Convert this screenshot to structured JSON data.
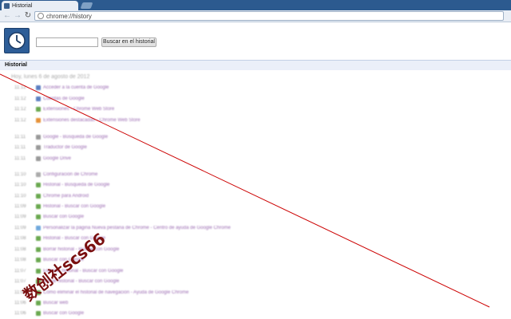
{
  "browser": {
    "tab_title": "Historial",
    "url_text": "chrome://history"
  },
  "page": {
    "search_placeholder": "",
    "search_button": "Buscar en el historial",
    "section_title": "Historial",
    "day_label": "Hoy, lunes 6 de agosto de 2012"
  },
  "entries": [
    {
      "time": "11:12",
      "title": "Acceder a la cuenta de Google",
      "fav": "#5b7fc1"
    },
    {
      "time": "11:12",
      "title": "Cuentas de Google",
      "fav": "#5b7fc1"
    },
    {
      "time": "11:12",
      "title": "Extensiones - Chrome Web Store",
      "fav": "#6aa84f"
    },
    {
      "time": "11:12",
      "title": "Extensiones destacadas - Chrome Web Store",
      "fav": "#e69138"
    },
    {
      "time": "11:11",
      "title": "Google - Búsqueda de Google",
      "fav": "#999999"
    },
    {
      "time": "11:11",
      "title": "Traductor de Google",
      "fav": "#999999"
    },
    {
      "time": "11:11",
      "title": "Google Drive",
      "fav": "#999999"
    },
    {
      "time": "11:10",
      "title": "Configuración de Chrome",
      "fav": "#aaaaaa"
    },
    {
      "time": "11:10",
      "title": "Historial - Búsqueda de Google",
      "fav": "#6aa84f"
    },
    {
      "time": "11:10",
      "title": "Chrome para Android",
      "fav": "#6aa84f"
    },
    {
      "time": "11:09",
      "title": "Historial - Buscar con Google",
      "fav": "#6aa84f"
    },
    {
      "time": "11:09",
      "title": "Buscar con Google",
      "fav": "#6aa84f"
    },
    {
      "time": "11:09",
      "title": "Personalizar la página Nueva pestaña de Chrome - Centro de ayuda de Google Chrome",
      "fav": "#6fa8dc"
    },
    {
      "time": "11:08",
      "title": "Historial - Buscar con Google",
      "fav": "#6aa84f"
    },
    {
      "time": "11:08",
      "title": "Borrar historial - Buscar con Google",
      "fav": "#6aa84f"
    },
    {
      "time": "11:08",
      "title": "Buscar con Google",
      "fav": "#6aa84f"
    },
    {
      "time": "11:07",
      "title": "Eliminar historial - Buscar con Google",
      "fav": "#6aa84f"
    },
    {
      "time": "11:07",
      "title": "Borrar historial - Buscar con Google",
      "fav": "#6aa84f"
    },
    {
      "time": "11:07",
      "title": "Cómo eliminar el historial de navegación - Ayuda de Google Chrome",
      "fav": "#6aa84f"
    },
    {
      "time": "11:06",
      "title": "Buscar web",
      "fav": "#6aa84f"
    },
    {
      "time": "11:06",
      "title": "Buscar con Google",
      "fav": "#6aa84f"
    }
  ],
  "watermark": "数创社scs66",
  "colors": {
    "tabstrip": "#2c5a8f",
    "toolbar": "#e9eef5",
    "logo": "#2d5d97",
    "visited_link": "#9b6bb2",
    "overlay_line": "#cc0000",
    "watermark": "#7a0f0f"
  }
}
